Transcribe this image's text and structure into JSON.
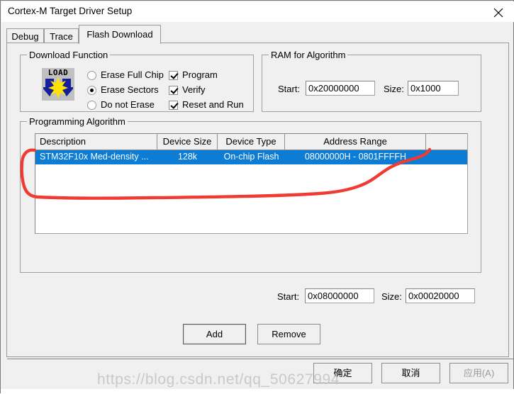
{
  "window": {
    "title": "Cortex-M Target Driver Setup",
    "close_icon": "close-icon"
  },
  "tabs": [
    {
      "id": "debug",
      "label": "Debug",
      "active": false
    },
    {
      "id": "trace",
      "label": "Trace",
      "active": false
    },
    {
      "id": "flash",
      "label": "Flash Download",
      "active": true
    }
  ],
  "download_function": {
    "title": "Download Function",
    "icon_label": "LOAD",
    "radios": [
      {
        "label": "Erase Full Chip",
        "selected": false
      },
      {
        "label": "Erase Sectors",
        "selected": true
      },
      {
        "label": "Do not Erase",
        "selected": false
      }
    ],
    "checkboxes": [
      {
        "label": "Program",
        "checked": true
      },
      {
        "label": "Verify",
        "checked": true
      },
      {
        "label": "Reset and Run",
        "checked": true
      }
    ]
  },
  "ram_for_algorithm": {
    "title": "RAM for Algorithm",
    "start_label": "Start:",
    "start_value": "0x20000000",
    "size_label": "Size:",
    "size_value": "0x1000"
  },
  "programming_algorithm": {
    "title": "Programming Algorithm",
    "columns": [
      "Description",
      "Device Size",
      "Device Type",
      "Address Range",
      ""
    ],
    "rows": [
      {
        "description": "STM32F10x Med-density ...",
        "device_size": "128k",
        "device_type": "On-chip Flash",
        "address_range": "08000000H - 0801FFFFH",
        "selected": true
      }
    ],
    "start_label": "Start:",
    "start_value": "0x08000000",
    "size_label": "Size:",
    "size_value": "0x00020000",
    "add_label": "Add",
    "remove_label": "Remove"
  },
  "footer": {
    "ok_label": "确定",
    "cancel_label": "取消",
    "apply_label": "应用(A)"
  },
  "watermark": {
    "text": "https://blog.csdn.net/qq_50627994"
  },
  "colors": {
    "selection_blue": "#0c7cd5",
    "annotation_red": "#f03b35",
    "dialog_background": "#f0f0f0",
    "field_background": "#ffffff"
  }
}
